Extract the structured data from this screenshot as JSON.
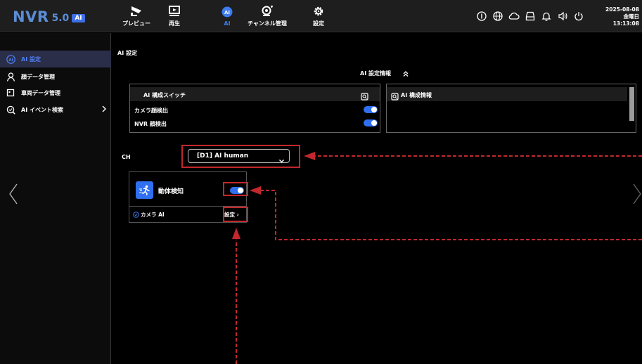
{
  "logo": {
    "name": "NVR",
    "version": "5.0",
    "badge": "AI"
  },
  "nav": [
    {
      "label": "プレビュー",
      "icon": "camera-icon"
    },
    {
      "label": "再生",
      "icon": "playback-icon"
    },
    {
      "label": "AI",
      "icon": "ai-icon",
      "active": true
    },
    {
      "label": "チャンネル管理",
      "icon": "channel-camera-icon"
    },
    {
      "label": "設定",
      "icon": "gear-icon"
    }
  ],
  "tray_icons": [
    "info-icon",
    "globe-icon",
    "cloud-icon",
    "storage-icon",
    "bell-icon",
    "volume-icon",
    "power-icon"
  ],
  "clock": {
    "date": "2025-08-08",
    "weekday": "金曜日",
    "time": "13:13:08"
  },
  "sidebar": {
    "items": [
      {
        "label": "AI 設定",
        "icon": "ai-circle-icon",
        "active": true
      },
      {
        "label": "顔データ管理",
        "icon": "person-icon"
      },
      {
        "label": "車両データ管理",
        "icon": "vehicle-data-icon"
      },
      {
        "label": "AI イベント検索",
        "icon": "search-icon",
        "has_submenu": true
      }
    ]
  },
  "main": {
    "section_title": "AI 設定",
    "info_title": "AI 設定情報",
    "switch_panel": {
      "header": "AI 構成スイッチ",
      "rows": [
        {
          "label": "カメラ顔検出",
          "enabled": true
        },
        {
          "label": "NVR 顔検出",
          "enabled": true
        }
      ]
    },
    "info_panel": {
      "header": "AI 構成情報"
    },
    "channel": {
      "label": "CH",
      "value": "[D1] AI human"
    },
    "feature_card": {
      "name": "動体検知",
      "enabled": true,
      "source": "カメラ AI",
      "settings_label": "設定 ›"
    }
  },
  "colors": {
    "accent": "#2f6ff0",
    "highlight": "#c1272d",
    "topbar": "#1e1e1e"
  }
}
